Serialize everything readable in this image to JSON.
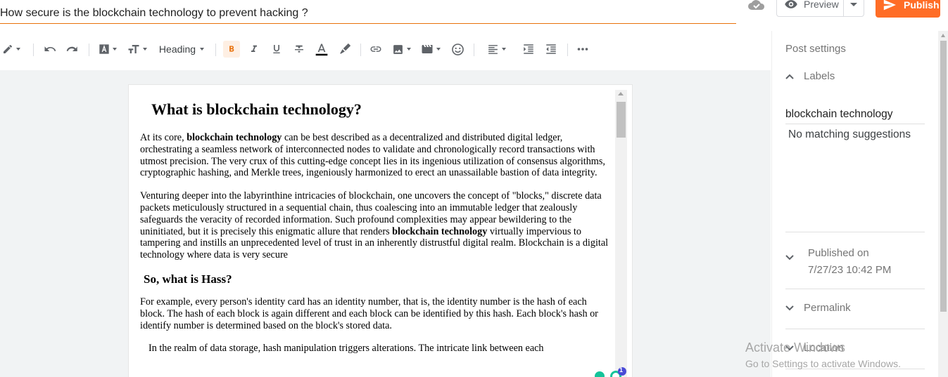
{
  "post": {
    "title": "How secure is the blockchain technology to prevent hacking  ?"
  },
  "header": {
    "preview_label": "Preview",
    "publish_label": "Publish"
  },
  "toolbar": {
    "heading_label": "Heading"
  },
  "content": {
    "h1": "What is blockchain technology?",
    "p1": {
      "a": "At its core, ",
      "b": "blockchain technology",
      "c": " can be best described as a decentralized and distributed digital ledger, orchestrating a seamless network of interconnected nodes to validate and chronologically record transactions with utmost precision. The very crux of this cutting-edge concept lies in its ingenious utilization of consensus algorithms, cryptographic hashing, and Merkle trees, ingeniously harmonized to erect an unassailable bastion of data integrity."
    },
    "p2": {
      "a": "Venturing deeper into the labyrinthine intricacies of blockchain, one uncovers the concept of \"blocks,\" discrete data packets meticulously structured in a sequential chain, thus coalescing into an immutable ledger that zealously safeguards the veracity of recorded information. Such profound complexities may appear bewildering to the uninitiated, but it is precisely this enigmatic allure that renders ",
      "b": "blockchain technology",
      "c": " virtually impervious to tampering and instills an unprecedented level of trust in an inherently distrustful digital realm. Blockchain is a digital technology where data is very secure"
    },
    "h2": "So, what is Hass?",
    "p3": "For example, every person's identity card has an identity number, that is, the identity number is the hash of each block. The hash of each block is again different and each block can be identified by this hash. Each block's hash or identify number is determined based on the block's stored data.",
    "p4": "In the realm of data storage, hash manipulation triggers alterations. The intricate link between each"
  },
  "sidebar": {
    "title": "Post settings",
    "labels_heading": "Labels",
    "labels_value": "blockchain technology",
    "labels_suggestion": "No matching suggestions",
    "published_heading": "Published on",
    "published_value": "7/27/23 10:42 PM",
    "permalink_heading": "Permalink",
    "location_heading": "Location"
  },
  "badge": {
    "count": "1"
  },
  "watermark": {
    "line1": "Activate Windows",
    "line2": "Go to Settings to activate Windows."
  },
  "colors": {
    "accent": "#ff6d26",
    "title_underline": "#e8710a",
    "bold_active_bg": "#feefe3"
  }
}
